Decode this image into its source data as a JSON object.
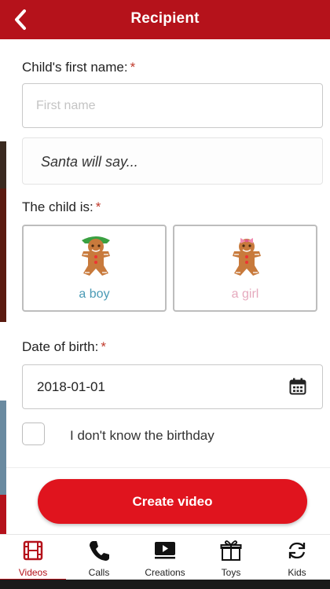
{
  "header": {
    "title": "Recipient",
    "back_icon": "chevron-left-icon"
  },
  "form": {
    "first_name": {
      "label": "Child's first name:",
      "required_mark": "*",
      "value": "",
      "placeholder": "First name"
    },
    "santa_say": {
      "text": "Santa will say..."
    },
    "gender": {
      "label": "The child is:",
      "required_mark": "*",
      "options": [
        {
          "label": "a boy",
          "icon": "gingerbread-boy-icon",
          "color": "#4a9ab5"
        },
        {
          "label": "a girl",
          "icon": "gingerbread-girl-icon",
          "color": "#e5a9bd"
        }
      ]
    },
    "birth_date": {
      "label": "Date of birth:",
      "required_mark": "*",
      "value": "2018-01-01",
      "icon": "calendar-icon"
    },
    "unknown_birthday": {
      "label": "I don't know the birthday",
      "checked": false
    },
    "submit_label": "Create video"
  },
  "tabbar": {
    "tabs": [
      {
        "label": "Videos",
        "icon": "film-icon",
        "active": true
      },
      {
        "label": "Calls",
        "icon": "phone-icon",
        "active": false
      },
      {
        "label": "Creations",
        "icon": "play-box-icon",
        "active": false
      },
      {
        "label": "Toys",
        "icon": "gift-icon",
        "active": false
      },
      {
        "label": "Kids",
        "icon": "refresh-icon",
        "active": false
      }
    ]
  },
  "colors": {
    "brand_red": "#b5121b",
    "button_red": "#e0141e",
    "required_red": "#c0392b"
  }
}
